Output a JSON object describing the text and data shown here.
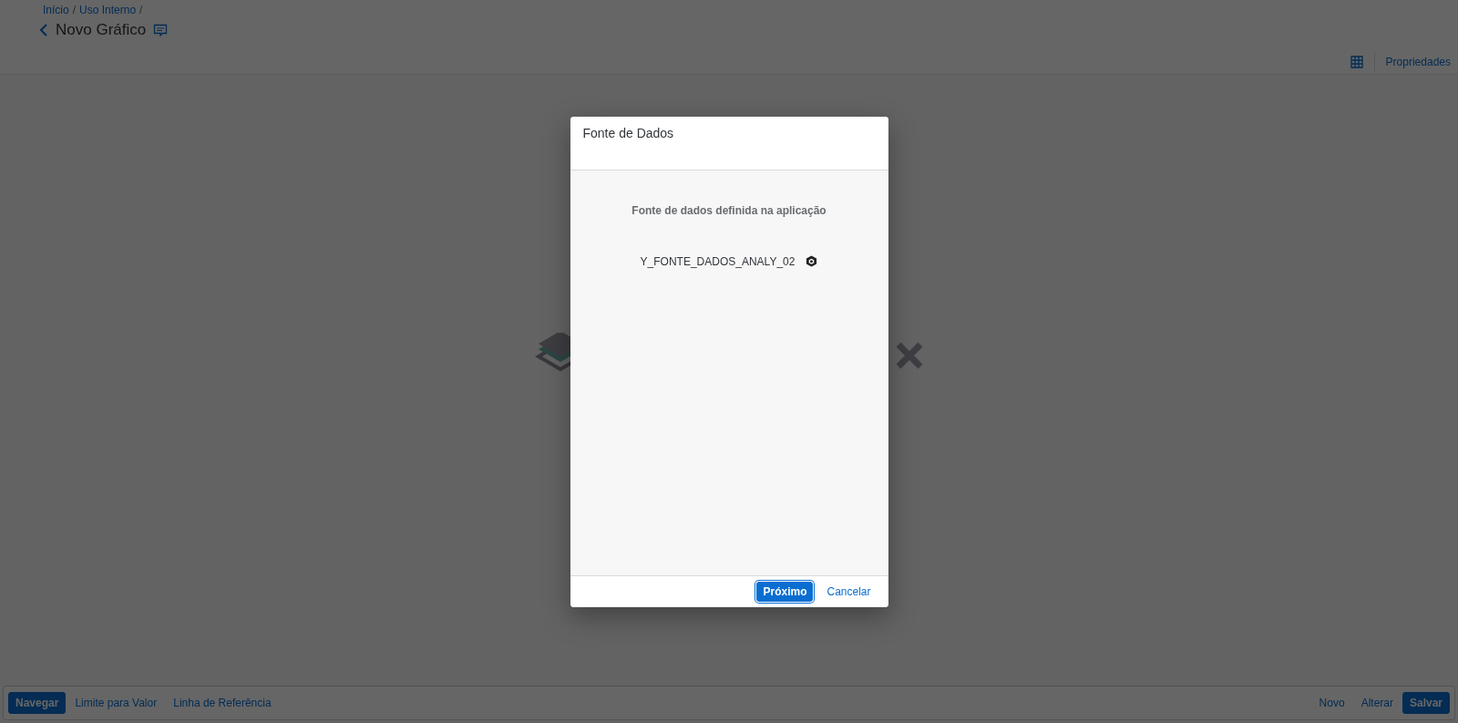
{
  "breadcrumbs": [
    {
      "label": "Início",
      "separator": "/"
    },
    {
      "label": "Uso Interno",
      "separator": "/"
    }
  ],
  "page_title": "Novo Gráfico",
  "toolbar": {
    "properties_label": "Propriedades"
  },
  "footer": {
    "left_buttons": [
      {
        "label": "Navegar",
        "kind": "emphasized"
      },
      {
        "label": "Limite para Valor",
        "kind": "transparent"
      },
      {
        "label": "Linha de Referência",
        "kind": "transparent"
      }
    ],
    "right_buttons": [
      {
        "label": "Novo",
        "kind": "transparent"
      },
      {
        "label": "Alterar",
        "kind": "transparent"
      },
      {
        "label": "Salvar",
        "kind": "emphasized"
      }
    ]
  },
  "dialog": {
    "title": "Fonte de Dados",
    "subtitle": "Fonte de dados definida na aplicação",
    "data_source": "Y_FONTE_DADOS_ANALY_02",
    "buttons": [
      {
        "label": "Próximo",
        "kind": "emphasized"
      },
      {
        "label": "Cancelar",
        "kind": "transparent"
      }
    ]
  }
}
